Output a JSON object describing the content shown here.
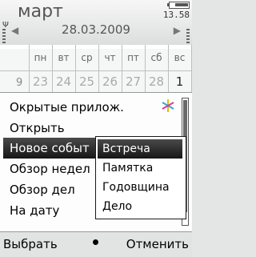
{
  "status": {
    "title": "март",
    "time": "13.58",
    "signal_glyph": "Ψ",
    "icons": [
      "battery-icon",
      "signal-icon"
    ]
  },
  "date_nav": {
    "date": "28.03.2009",
    "prev_glyph": "◀",
    "next_glyph": "▶"
  },
  "calendar": {
    "weekdays": [
      "пн",
      "вт",
      "ср",
      "чт",
      "пт",
      "сб",
      "вс"
    ],
    "week_number": "9",
    "days": [
      "23",
      "24",
      "25",
      "26",
      "27",
      "28",
      "1"
    ]
  },
  "menu": {
    "items": [
      "Окрытые прилож.",
      "Открыть",
      "Новое событ",
      "Обзор недел",
      "Обзор дел",
      "На дату"
    ],
    "selected_index": 2
  },
  "submenu": {
    "items": [
      "Встреча",
      "Памятка",
      "Годовщина",
      "Дело"
    ],
    "selected_index": 0
  },
  "softkeys": {
    "left": "Выбрать",
    "right": "Отменить"
  },
  "colors": {
    "highlight": "#1e1e1e",
    "background": "#e4e6e6"
  }
}
